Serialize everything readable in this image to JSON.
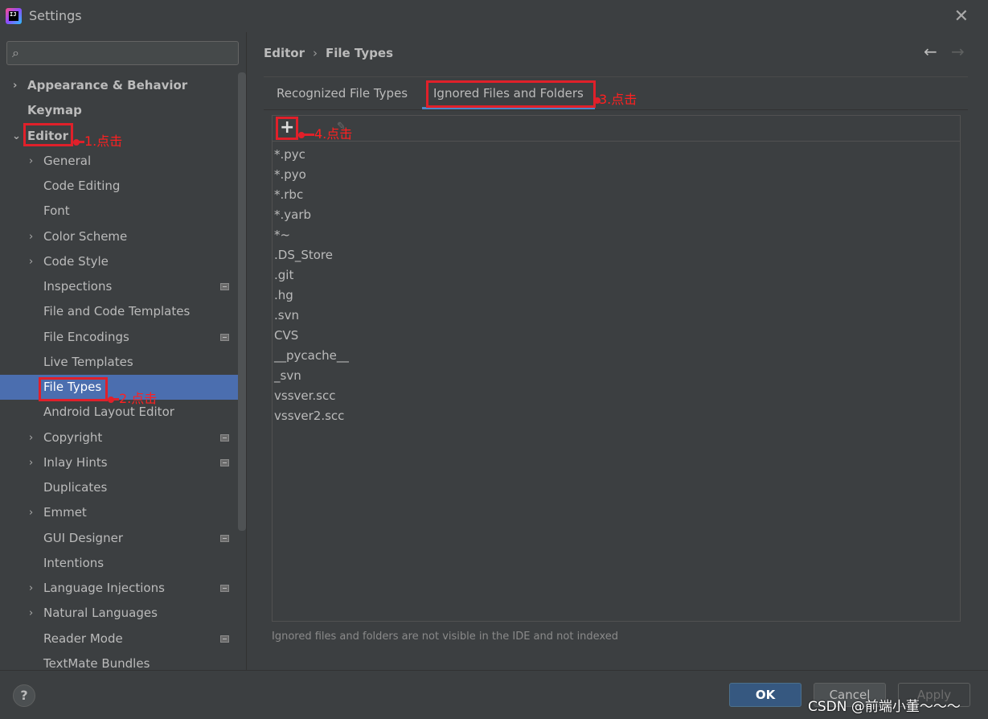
{
  "window": {
    "title": "Settings",
    "close_glyph": "✕",
    "app_icon_text": "IJ"
  },
  "search": {
    "placeholder": "",
    "icon_glyph": "⌕"
  },
  "sidebar": {
    "items": [
      {
        "label": "Appearance & Behavior",
        "arrow": "›"
      },
      {
        "label": "Keymap",
        "arrow": ""
      },
      {
        "label": "Editor",
        "arrow": "⌄"
      },
      {
        "label": "General",
        "arrow": "›"
      },
      {
        "label": "Code Editing",
        "arrow": ""
      },
      {
        "label": "Font",
        "arrow": ""
      },
      {
        "label": "Color Scheme",
        "arrow": "›"
      },
      {
        "label": "Code Style",
        "arrow": "›"
      },
      {
        "label": "Inspections",
        "arrow": ""
      },
      {
        "label": "File and Code Templates",
        "arrow": ""
      },
      {
        "label": "File Encodings",
        "arrow": ""
      },
      {
        "label": "Live Templates",
        "arrow": ""
      },
      {
        "label": "File Types",
        "arrow": ""
      },
      {
        "label": "Android Layout Editor",
        "arrow": ""
      },
      {
        "label": "Copyright",
        "arrow": "›"
      },
      {
        "label": "Inlay Hints",
        "arrow": "›"
      },
      {
        "label": "Duplicates",
        "arrow": ""
      },
      {
        "label": "Emmet",
        "arrow": "›"
      },
      {
        "label": "GUI Designer",
        "arrow": ""
      },
      {
        "label": "Intentions",
        "arrow": ""
      },
      {
        "label": "Language Injections",
        "arrow": "›"
      },
      {
        "label": "Natural Languages",
        "arrow": "›"
      },
      {
        "label": "Reader Mode",
        "arrow": ""
      },
      {
        "label": "TextMate Bundles",
        "arrow": ""
      }
    ]
  },
  "breadcrumb": {
    "parent": "Editor",
    "separator": "›",
    "current": "File Types"
  },
  "nav": {
    "back": "←",
    "forward": "→"
  },
  "tabs": [
    {
      "label": "Recognized File Types"
    },
    {
      "label": "Ignored Files and Folders"
    }
  ],
  "toolbar": {
    "add_glyph": "+",
    "edit_glyph": "✎"
  },
  "ignored_list": [
    "*.pyc",
    "*.pyo",
    "*.rbc",
    "*.yarb",
    "*~",
    ".DS_Store",
    ".git",
    ".hg",
    ".svn",
    "CVS",
    "__pycache__",
    "_svn",
    "vssver.scc",
    "vssver2.scc"
  ],
  "hint": "Ignored files and folders are not visible in the IDE and not indexed",
  "footer": {
    "help": "?",
    "ok": "OK",
    "cancel": "Cancel",
    "apply": "Apply"
  },
  "annotations": {
    "step1": "1.点击",
    "step2": "2.点击",
    "step3": "3.点击",
    "step4": "4.点击"
  },
  "watermark": "CSDN @前端小董～～～",
  "colors": {
    "background": "#3c3f41",
    "selection": "#4b6eaf",
    "tab_accent": "#4a88c7",
    "ok_button": "#365880",
    "annotation_red": "#e0202a"
  }
}
